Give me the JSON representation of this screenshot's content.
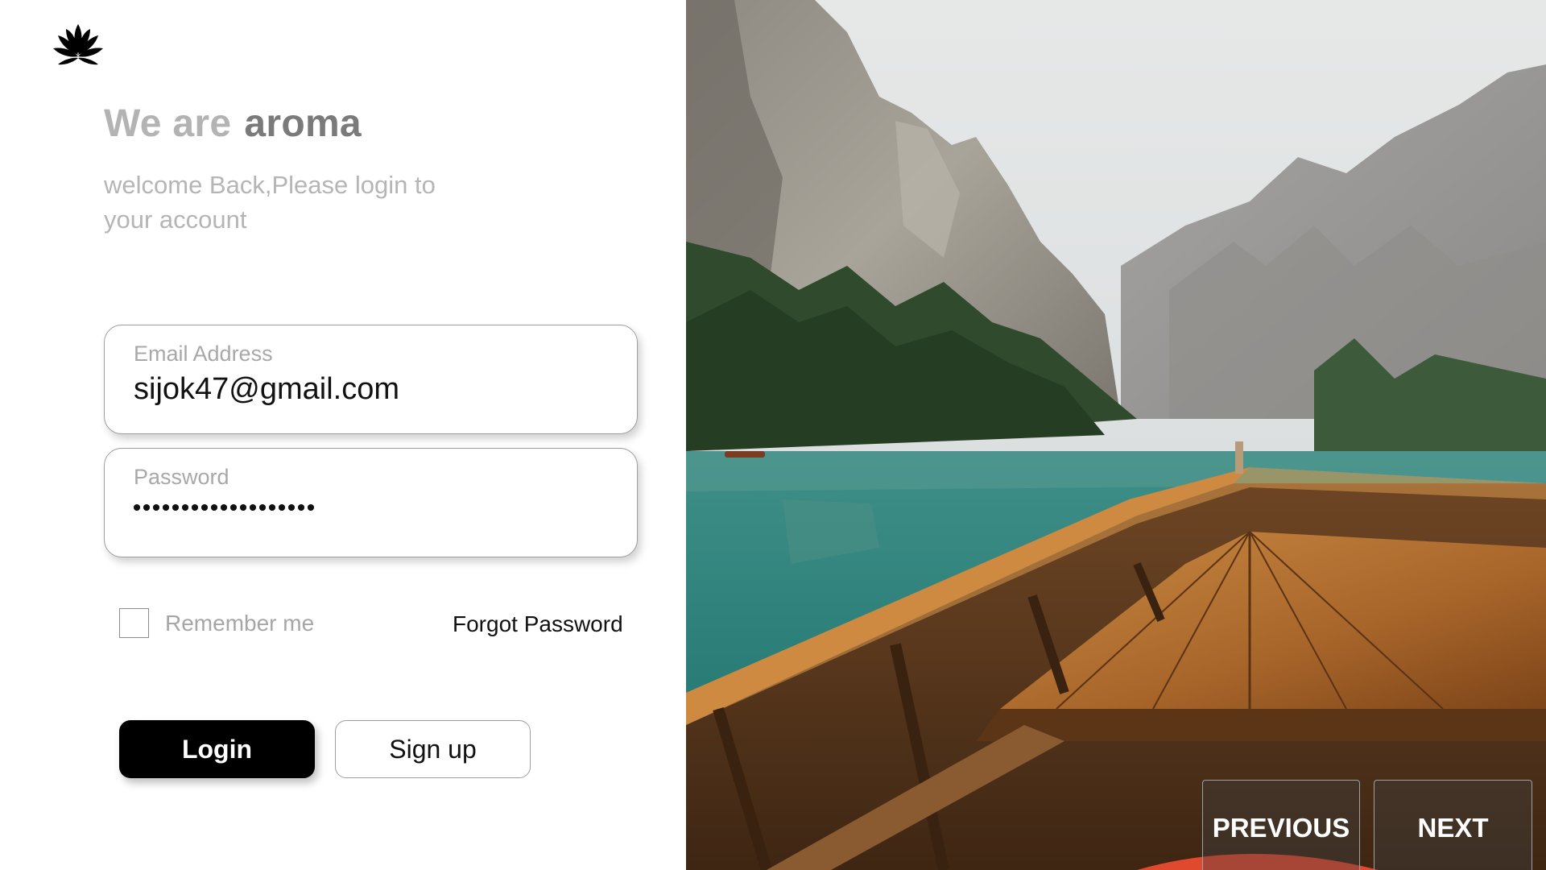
{
  "brand": {
    "logo_icon": "lotus-flower-icon",
    "headline_prefix": "We are",
    "headline_brand": "aroma",
    "subtitle": "welcome Back,Please login to your account"
  },
  "login_form": {
    "email": {
      "label": "Email Address",
      "value": "sijok47@gmail.com"
    },
    "password": {
      "label": "Password",
      "masked_length": 19
    },
    "remember_me_label": "Remember me",
    "remember_me_checked": false,
    "forgot_password_label": "Forgot Password",
    "login_label": "Login",
    "signup_label": "Sign up"
  },
  "carousel": {
    "image": "mountain-lake-boat-photo",
    "previous_label": "PREVIOUS",
    "next_label": "NEXT"
  },
  "colors": {
    "primary_button": "#000000",
    "headline_muted": "#b3b3b3",
    "headline_brand": "#7a7a7a",
    "water": "#2f8a84",
    "boat_wood": "#b86f2c"
  }
}
